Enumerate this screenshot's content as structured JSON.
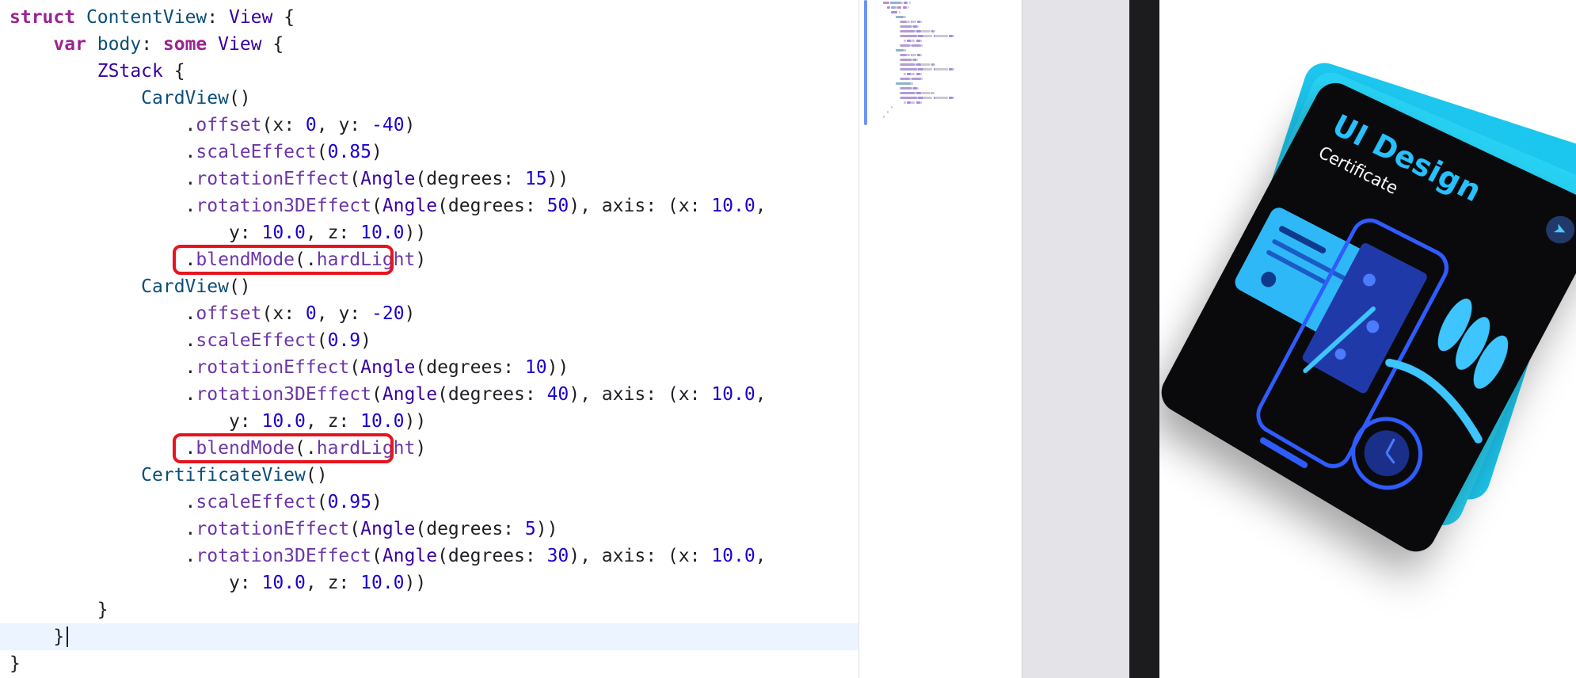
{
  "code": {
    "lines": [
      [
        {
          "t": "struct",
          "c": "kw"
        },
        {
          "t": " ",
          "c": "plain"
        },
        {
          "t": "ContentView",
          "c": "ty"
        },
        {
          "t": ": ",
          "c": "plain"
        },
        {
          "t": "View",
          "c": "tyb"
        },
        {
          "t": " {",
          "c": "plain"
        }
      ],
      [
        {
          "t": "    ",
          "c": "plain"
        },
        {
          "t": "var",
          "c": "kw"
        },
        {
          "t": " ",
          "c": "plain"
        },
        {
          "t": "body",
          "c": "ty"
        },
        {
          "t": ": ",
          "c": "plain"
        },
        {
          "t": "some",
          "c": "kw"
        },
        {
          "t": " ",
          "c": "plain"
        },
        {
          "t": "View",
          "c": "tyb"
        },
        {
          "t": " {",
          "c": "plain"
        }
      ],
      [
        {
          "t": "        ",
          "c": "plain"
        },
        {
          "t": "ZStack",
          "c": "tyb"
        },
        {
          "t": " {",
          "c": "plain"
        }
      ],
      [
        {
          "t": "            ",
          "c": "plain"
        },
        {
          "t": "CardView",
          "c": "ty"
        },
        {
          "t": "()",
          "c": "plain"
        }
      ],
      [
        {
          "t": "                .",
          "c": "plain"
        },
        {
          "t": "offset",
          "c": "mem"
        },
        {
          "t": "(x: ",
          "c": "plain"
        },
        {
          "t": "0",
          "c": "num"
        },
        {
          "t": ", y: ",
          "c": "plain"
        },
        {
          "t": "-40",
          "c": "num"
        },
        {
          "t": ")",
          "c": "plain"
        }
      ],
      [
        {
          "t": "                .",
          "c": "plain"
        },
        {
          "t": "scaleEffect",
          "c": "mem"
        },
        {
          "t": "(",
          "c": "plain"
        },
        {
          "t": "0.85",
          "c": "num"
        },
        {
          "t": ")",
          "c": "plain"
        }
      ],
      [
        {
          "t": "                .",
          "c": "plain"
        },
        {
          "t": "rotationEffect",
          "c": "mem"
        },
        {
          "t": "(",
          "c": "plain"
        },
        {
          "t": "Angle",
          "c": "tyb"
        },
        {
          "t": "(degrees: ",
          "c": "plain"
        },
        {
          "t": "15",
          "c": "num"
        },
        {
          "t": "))",
          "c": "plain"
        }
      ],
      [
        {
          "t": "                .",
          "c": "plain"
        },
        {
          "t": "rotation3DEffect",
          "c": "mem"
        },
        {
          "t": "(",
          "c": "plain"
        },
        {
          "t": "Angle",
          "c": "tyb"
        },
        {
          "t": "(degrees: ",
          "c": "plain"
        },
        {
          "t": "50",
          "c": "num"
        },
        {
          "t": "), axis: (x: ",
          "c": "plain"
        },
        {
          "t": "10.0",
          "c": "num"
        },
        {
          "t": ",",
          "c": "plain"
        }
      ],
      [
        {
          "t": "                    y: ",
          "c": "plain"
        },
        {
          "t": "10.0",
          "c": "num"
        },
        {
          "t": ", z: ",
          "c": "plain"
        },
        {
          "t": "10.0",
          "c": "num"
        },
        {
          "t": "))",
          "c": "plain"
        }
      ],
      [
        {
          "t": "                .",
          "c": "plain"
        },
        {
          "t": "blendMode",
          "c": "mem"
        },
        {
          "t": "(.",
          "c": "plain"
        },
        {
          "t": "hardLight",
          "c": "mem"
        },
        {
          "t": ")",
          "c": "plain"
        }
      ],
      [
        {
          "t": "            ",
          "c": "plain"
        },
        {
          "t": "CardView",
          "c": "ty"
        },
        {
          "t": "()",
          "c": "plain"
        }
      ],
      [
        {
          "t": "                .",
          "c": "plain"
        },
        {
          "t": "offset",
          "c": "mem"
        },
        {
          "t": "(x: ",
          "c": "plain"
        },
        {
          "t": "0",
          "c": "num"
        },
        {
          "t": ", y: ",
          "c": "plain"
        },
        {
          "t": "-20",
          "c": "num"
        },
        {
          "t": ")",
          "c": "plain"
        }
      ],
      [
        {
          "t": "                .",
          "c": "plain"
        },
        {
          "t": "scaleEffect",
          "c": "mem"
        },
        {
          "t": "(",
          "c": "plain"
        },
        {
          "t": "0.9",
          "c": "num"
        },
        {
          "t": ")",
          "c": "plain"
        }
      ],
      [
        {
          "t": "                .",
          "c": "plain"
        },
        {
          "t": "rotationEffect",
          "c": "mem"
        },
        {
          "t": "(",
          "c": "plain"
        },
        {
          "t": "Angle",
          "c": "tyb"
        },
        {
          "t": "(degrees: ",
          "c": "plain"
        },
        {
          "t": "10",
          "c": "num"
        },
        {
          "t": "))",
          "c": "plain"
        }
      ],
      [
        {
          "t": "                .",
          "c": "plain"
        },
        {
          "t": "rotation3DEffect",
          "c": "mem"
        },
        {
          "t": "(",
          "c": "plain"
        },
        {
          "t": "Angle",
          "c": "tyb"
        },
        {
          "t": "(degrees: ",
          "c": "plain"
        },
        {
          "t": "40",
          "c": "num"
        },
        {
          "t": "), axis: (x: ",
          "c": "plain"
        },
        {
          "t": "10.0",
          "c": "num"
        },
        {
          "t": ",",
          "c": "plain"
        }
      ],
      [
        {
          "t": "                    y: ",
          "c": "plain"
        },
        {
          "t": "10.0",
          "c": "num"
        },
        {
          "t": ", z: ",
          "c": "plain"
        },
        {
          "t": "10.0",
          "c": "num"
        },
        {
          "t": "))",
          "c": "plain"
        }
      ],
      [
        {
          "t": "                .",
          "c": "plain"
        },
        {
          "t": "blendMode",
          "c": "mem"
        },
        {
          "t": "(.",
          "c": "plain"
        },
        {
          "t": "hardLight",
          "c": "mem"
        },
        {
          "t": ")",
          "c": "plain"
        }
      ],
      [
        {
          "t": "            ",
          "c": "plain"
        },
        {
          "t": "CertificateView",
          "c": "ty"
        },
        {
          "t": "()",
          "c": "plain"
        }
      ],
      [
        {
          "t": "                .",
          "c": "plain"
        },
        {
          "t": "scaleEffect",
          "c": "mem"
        },
        {
          "t": "(",
          "c": "plain"
        },
        {
          "t": "0.95",
          "c": "num"
        },
        {
          "t": ")",
          "c": "plain"
        }
      ],
      [
        {
          "t": "                .",
          "c": "plain"
        },
        {
          "t": "rotationEffect",
          "c": "mem"
        },
        {
          "t": "(",
          "c": "plain"
        },
        {
          "t": "Angle",
          "c": "tyb"
        },
        {
          "t": "(degrees: ",
          "c": "plain"
        },
        {
          "t": "5",
          "c": "num"
        },
        {
          "t": "))",
          "c": "plain"
        }
      ],
      [
        {
          "t": "                .",
          "c": "plain"
        },
        {
          "t": "rotation3DEffect",
          "c": "mem"
        },
        {
          "t": "(",
          "c": "plain"
        },
        {
          "t": "Angle",
          "c": "tyb"
        },
        {
          "t": "(degrees: ",
          "c": "plain"
        },
        {
          "t": "30",
          "c": "num"
        },
        {
          "t": "), axis: (x: ",
          "c": "plain"
        },
        {
          "t": "10.0",
          "c": "num"
        },
        {
          "t": ",",
          "c": "plain"
        }
      ],
      [
        {
          "t": "                    y: ",
          "c": "plain"
        },
        {
          "t": "10.0",
          "c": "num"
        },
        {
          "t": ", z: ",
          "c": "plain"
        },
        {
          "t": "10.0",
          "c": "num"
        },
        {
          "t": "))",
          "c": "plain"
        }
      ],
      [
        {
          "t": "        }",
          "c": "plain"
        }
      ],
      [
        {
          "t": "    }",
          "c": "plain"
        }
      ],
      [
        {
          "t": "}",
          "c": "plain"
        }
      ]
    ],
    "current_line": 24,
    "highlighted_lines": [
      10,
      17
    ]
  },
  "preview": {
    "certificate_title": "UI Design",
    "certificate_subtitle": "Certificate",
    "swift_logo_icon": "swift-logo-icon"
  },
  "colors": {
    "keyword": "#9b2393",
    "type": "#0b4f79",
    "member": "#6c36a9",
    "number": "#1c00cf",
    "highlight_box": "#e6141e",
    "accent_blue": "#27c1ff"
  }
}
